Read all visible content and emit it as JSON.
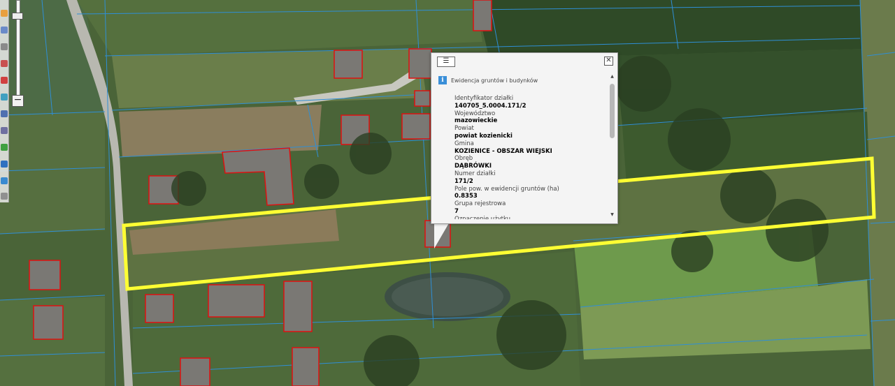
{
  "popup": {
    "section_title": "Ewidencja gruntów i budynków",
    "attributes": [
      {
        "label": "Identyfikator działki",
        "value": "140705_5.0004.171/2"
      },
      {
        "label": "Województwo",
        "value": "mazowieckie"
      },
      {
        "label": "Powiat",
        "value": "powiat kozienicki"
      },
      {
        "label": "Gmina",
        "value": "KOZIENICE - OBSZAR WIEJSKI"
      },
      {
        "label": "Obręb",
        "value": "DĄBRÓWKI"
      },
      {
        "label": "Numer działki",
        "value": "171/2"
      },
      {
        "label": "Pole pow. w ewidencji gruntów (ha)",
        "value": "0.8353"
      },
      {
        "label": "Grupa rejestrowa",
        "value": "7"
      },
      {
        "label": "Oznaczenie użytku",
        "value": ""
      }
    ]
  },
  "icons": {
    "menu": "list-icon",
    "close": "close-icon",
    "info": "info-icon",
    "zoom_out": "minus-icon"
  },
  "colors": {
    "parcel_highlight": "#ffff33",
    "parcel_boundary": "#2f8fd6",
    "building_outline": "#e01010"
  }
}
